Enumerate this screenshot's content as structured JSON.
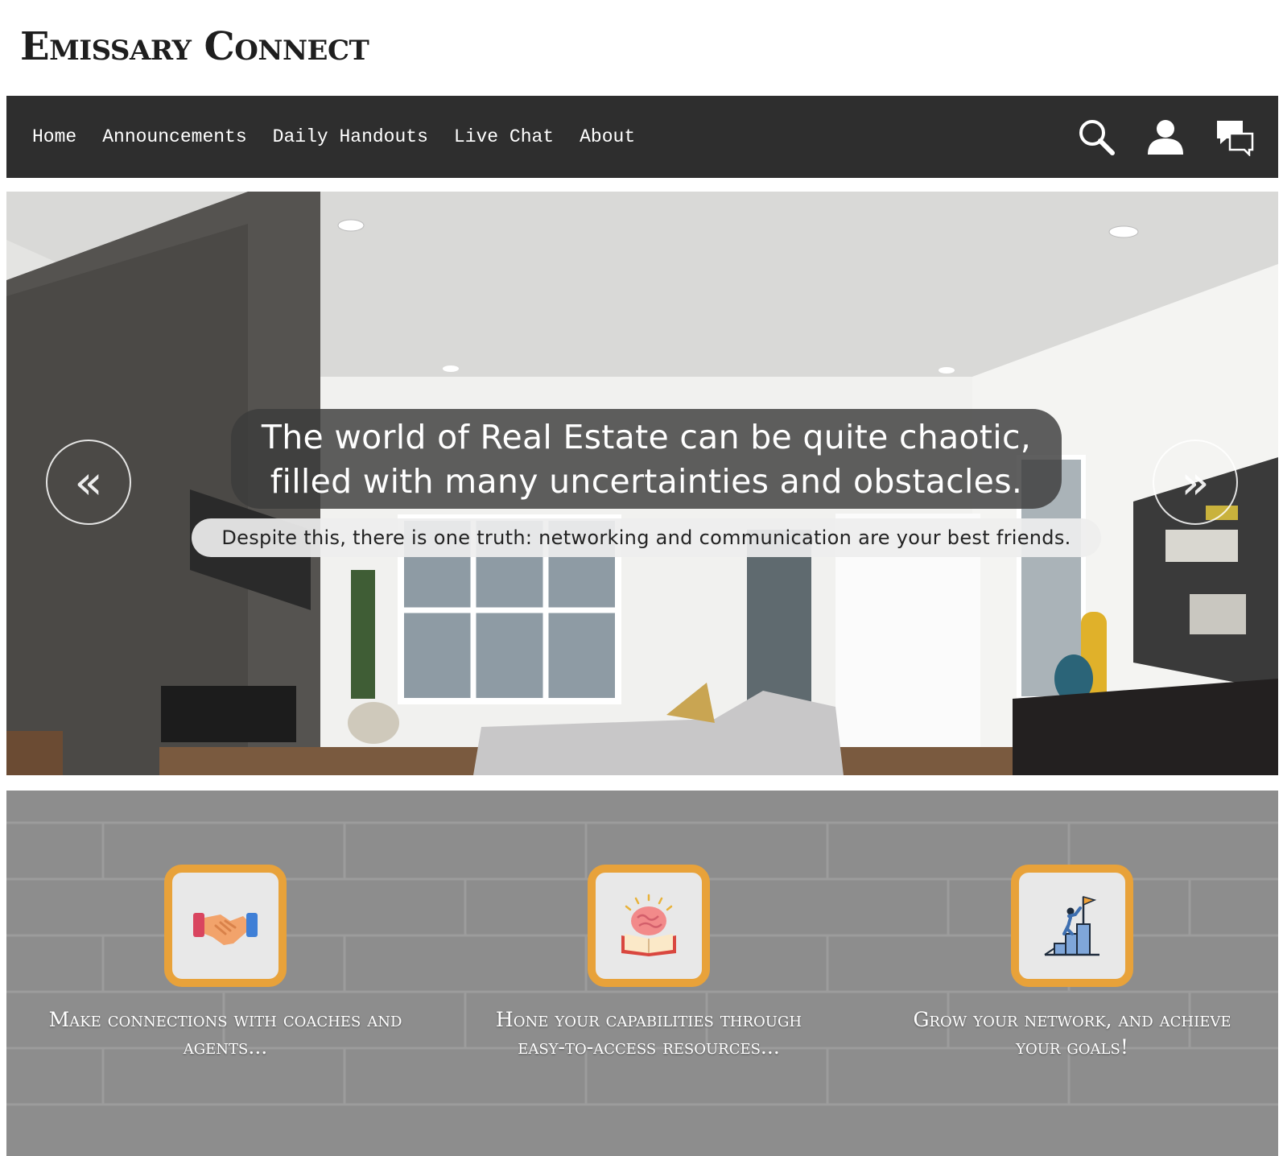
{
  "site": {
    "logo_text": "Emissary Connect"
  },
  "nav": {
    "links": [
      "Home",
      "Announcements",
      "Daily Handouts",
      "Live Chat",
      "About"
    ],
    "icons": [
      "search-icon",
      "user-icon",
      "chat-icon"
    ]
  },
  "hero": {
    "headline_line1": "The world of Real Estate can be quite chaotic,",
    "headline_line2": "filled with many uncertainties and obstacles.",
    "subline": "Despite this, there is one truth: networking and communication are your best friends.",
    "prev_label": "«",
    "next_label": "»"
  },
  "features": [
    {
      "icon": "handshake-icon",
      "text_line1": "Make connections with coaches and",
      "text_line2": "agents..."
    },
    {
      "icon": "brain-book-icon",
      "text_line1": "Hone your capabilities through",
      "text_line2": "easy-to-access resources..."
    },
    {
      "icon": "climb-flag-icon",
      "text_line1": "Grow your network, and achieve",
      "text_line2": "your goals!"
    }
  ],
  "colors": {
    "nav_bg": "#2e2e2e",
    "accent_border": "#e8a23a",
    "brick": "#8c8c8c"
  }
}
